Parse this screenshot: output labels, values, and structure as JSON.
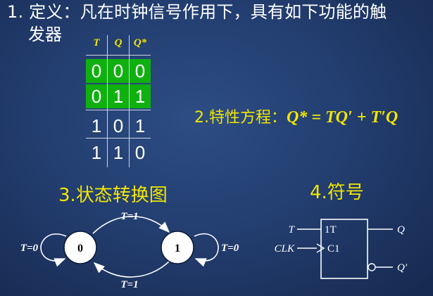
{
  "heading": {
    "line1": "1. 定义：凡在时钟信号作用下，具有如下功能的触",
    "line2": "发器"
  },
  "truth_table": {
    "headers": [
      "T",
      "Q",
      "Q*"
    ],
    "rows": [
      {
        "cells": [
          "0",
          "0",
          "0"
        ],
        "highlight": true
      },
      {
        "cells": [
          "0",
          "1",
          "1"
        ],
        "highlight": true
      },
      {
        "cells": [
          "1",
          "0",
          "1"
        ],
        "highlight": false
      },
      {
        "cells": [
          "1",
          "1",
          "0"
        ],
        "highlight": false
      }
    ],
    "highlight_color": "#10b010",
    "header_color": "#f2e600"
  },
  "characteristic": {
    "label": "2.特性方程：",
    "formula": "Q* = TQ′ + T′Q"
  },
  "state_diagram": {
    "title": "3.状态转换图",
    "states": [
      "0",
      "1"
    ],
    "transitions": {
      "top": "T=1",
      "bottom": "T=1",
      "self_0": "T=0",
      "self_1": "T=0"
    }
  },
  "symbol": {
    "title": "4.符号",
    "inputs": {
      "t": "T",
      "clk": "CLK"
    },
    "inner": {
      "t": "1T",
      "clk": "C1"
    },
    "outputs": {
      "q": "Q",
      "qn": "Q′"
    }
  },
  "colors": {
    "accent_yellow": "#f2e600",
    "background": "#233e70",
    "text": "#ffffff"
  }
}
